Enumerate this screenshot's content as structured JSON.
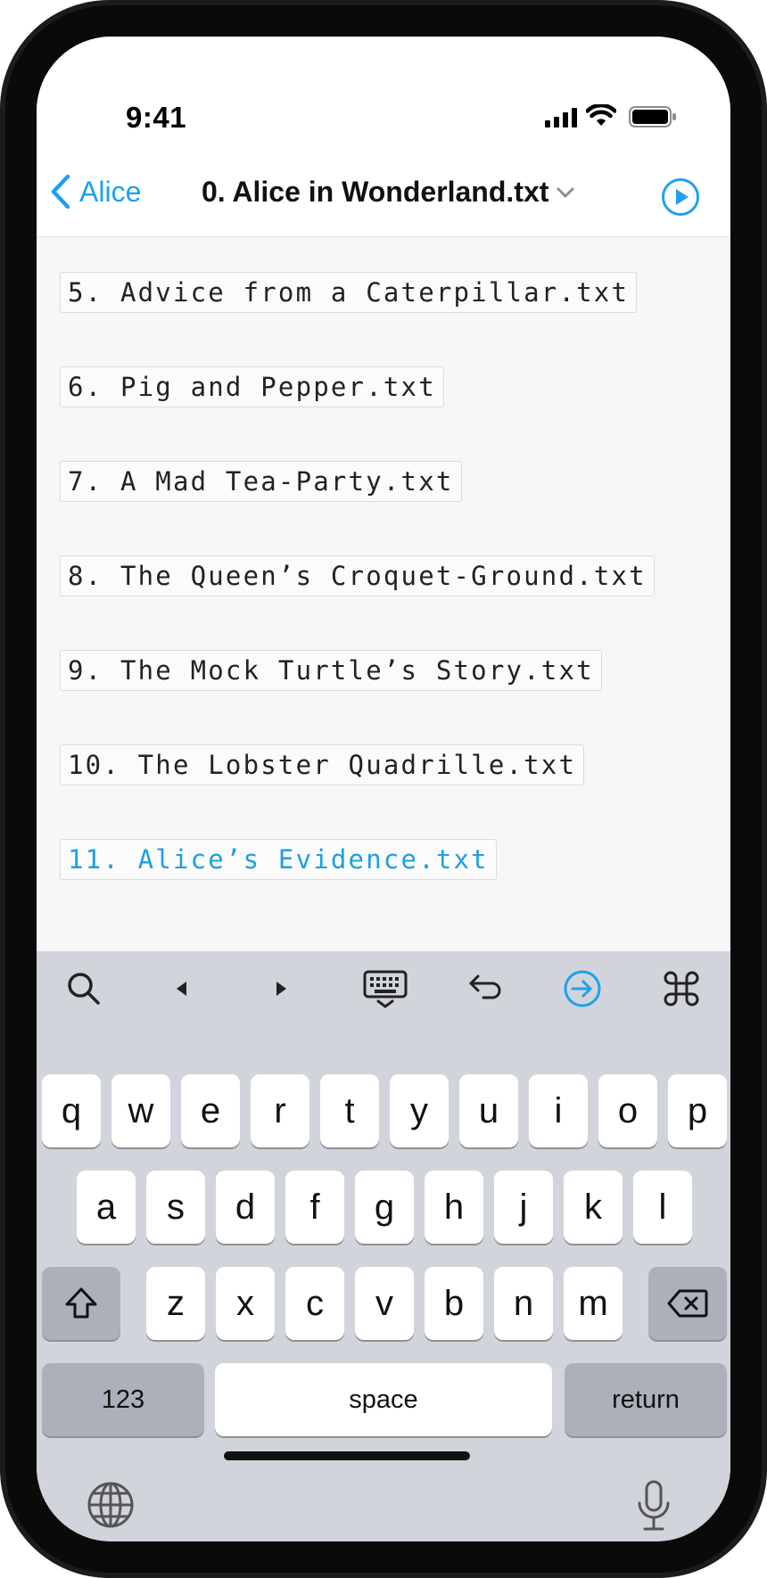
{
  "status": {
    "time": "9:41"
  },
  "nav": {
    "back_label": "Alice",
    "title": "0. Alice in Wonderland.txt"
  },
  "files": [
    "5. Advice from a Caterpillar.txt",
    "6. Pig and Pepper.txt",
    "7. A Mad Tea-Party.txt",
    "8. The Queen’s Croquet-Ground.txt",
    "9. The Mock Turtle’s Story.txt",
    "10. The Lobster Quadrille.txt",
    "11. Alice’s Evidence.txt"
  ],
  "active_file_index": 6,
  "colors": {
    "accent": "#1ea1ee",
    "active_text": "#1ba0e2"
  },
  "toolbar": {
    "icons": [
      "search-icon",
      "left-arrow-icon",
      "right-arrow-icon",
      "keyboard-dismiss-icon",
      "undo-icon",
      "go-icon",
      "command-icon"
    ]
  },
  "keyboard": {
    "row1": [
      "q",
      "w",
      "e",
      "r",
      "t",
      "y",
      "u",
      "i",
      "o",
      "p"
    ],
    "row2": [
      "a",
      "s",
      "d",
      "f",
      "g",
      "h",
      "j",
      "k",
      "l"
    ],
    "row3": [
      "z",
      "x",
      "c",
      "v",
      "b",
      "n",
      "m"
    ],
    "numbers_label": "123",
    "space_label": "space",
    "return_label": "return"
  }
}
